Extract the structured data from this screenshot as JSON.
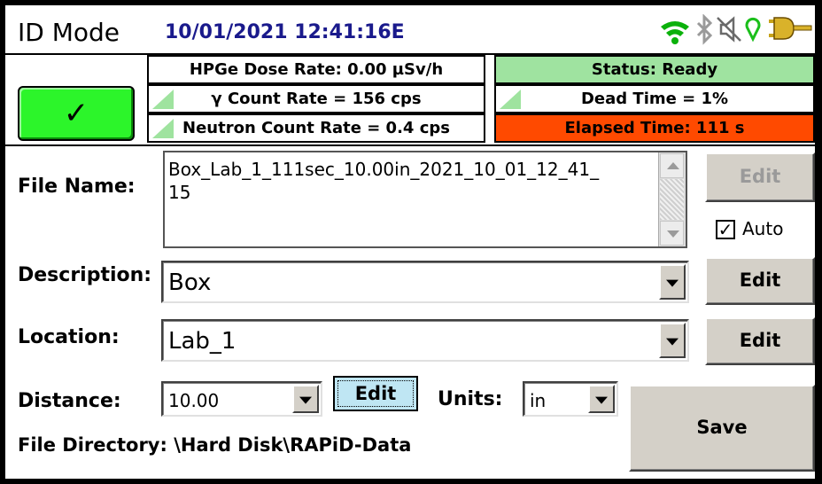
{
  "header": {
    "mode": "ID Mode",
    "datetime": "10/01/2021 12:41:16E",
    "icons": [
      "wifi-icon",
      "bluetooth-icon",
      "speaker-muted-icon",
      "location-pin-icon",
      "power-plug-icon"
    ]
  },
  "status_panel": {
    "ok_symbol": "✓",
    "hpge_dose_rate": "HPGe Dose Rate: 0.00  µSv/h",
    "gamma_count_rate": "γ Count Rate = 156 cps",
    "neutron_count_rate": "Neutron Count Rate = 0.4 cps",
    "status": "Status: Ready",
    "dead_time": "Dead Time = 1%",
    "elapsed_time": "Elapsed Time: 111 s",
    "colors": {
      "ok_button": "#2cf52a",
      "status_ready": "#9fe3a0",
      "elapsed": "#ff4a00"
    }
  },
  "form": {
    "file_name_label": "File Name:",
    "file_name_line1": "Box_Lab_1_111sec_10.00in_2021_10_01_12_41_",
    "file_name_line2": "15",
    "file_name_edit": "Edit",
    "auto_label": "Auto",
    "auto_checked": true,
    "description_label": "Description:",
    "description_value": "Box",
    "description_edit": "Edit",
    "location_label": "Location:",
    "location_value": "Lab_1",
    "location_edit": "Edit",
    "distance_label": "Distance:",
    "distance_value": "10.00",
    "distance_edit": "Edit",
    "units_label": "Units:",
    "units_value": "in",
    "save_label": "Save",
    "file_directory": "File Directory: \\Hard Disk\\RAPiD-Data"
  }
}
